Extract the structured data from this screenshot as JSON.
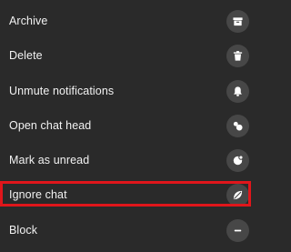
{
  "menu": {
    "items": [
      {
        "label": "Archive",
        "icon": "archive-icon"
      },
      {
        "label": "Delete",
        "icon": "trash-icon"
      },
      {
        "label": "Unmute notifications",
        "icon": "bell-icon"
      },
      {
        "label": "Open chat head",
        "icon": "chat-bubbles-icon"
      },
      {
        "label": "Mark as unread",
        "icon": "unread-badge-icon"
      },
      {
        "label": "Ignore chat",
        "icon": "ignore-leaf-icon"
      },
      {
        "label": "Block",
        "icon": "block-minus-icon"
      }
    ],
    "highlighted_item": "Ignore chat",
    "colors": {
      "background": "#2a2a2a",
      "text": "#f2f2f2",
      "icon_circle": "#474747",
      "icon_glyph": "#ffffff",
      "highlight_border": "#e0161b"
    }
  }
}
